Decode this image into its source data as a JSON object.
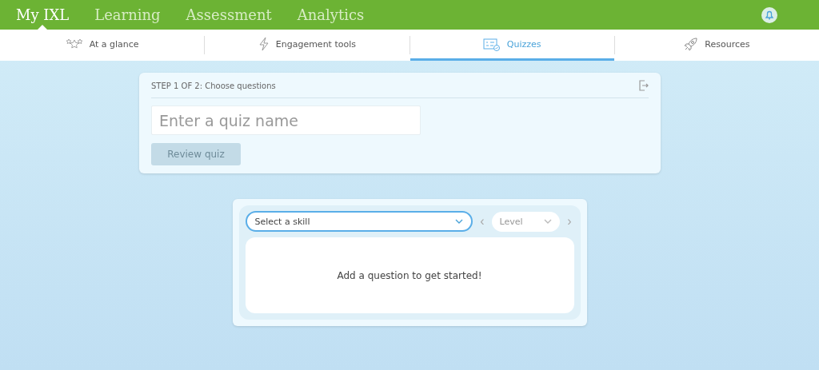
{
  "top_nav": [
    {
      "label": "My IXL",
      "selected": true
    },
    {
      "label": "Learning",
      "selected": false
    },
    {
      "label": "Assessment",
      "selected": false
    },
    {
      "label": "Analytics",
      "selected": false
    }
  ],
  "sub_tabs": [
    {
      "label": "At a glance",
      "kind": "stars",
      "selected": false
    },
    {
      "label": "Engagement tools",
      "kind": "bolt",
      "selected": false
    },
    {
      "label": "Quizzes",
      "kind": "quiz",
      "selected": true
    },
    {
      "label": "Resources",
      "kind": "rocket",
      "selected": false
    }
  ],
  "quiz_card": {
    "step": "STEP 1 OF 2: Choose questions",
    "name_field": {
      "placeholder": "Enter a quiz name"
    },
    "review_button": {
      "label": "Review quiz",
      "disabled": true
    }
  },
  "question_panel": {
    "skill_select": "Select a skill",
    "level_select": "Level",
    "prev": "‹",
    "next": "›",
    "empty_message": "Add a question to get started!"
  }
}
